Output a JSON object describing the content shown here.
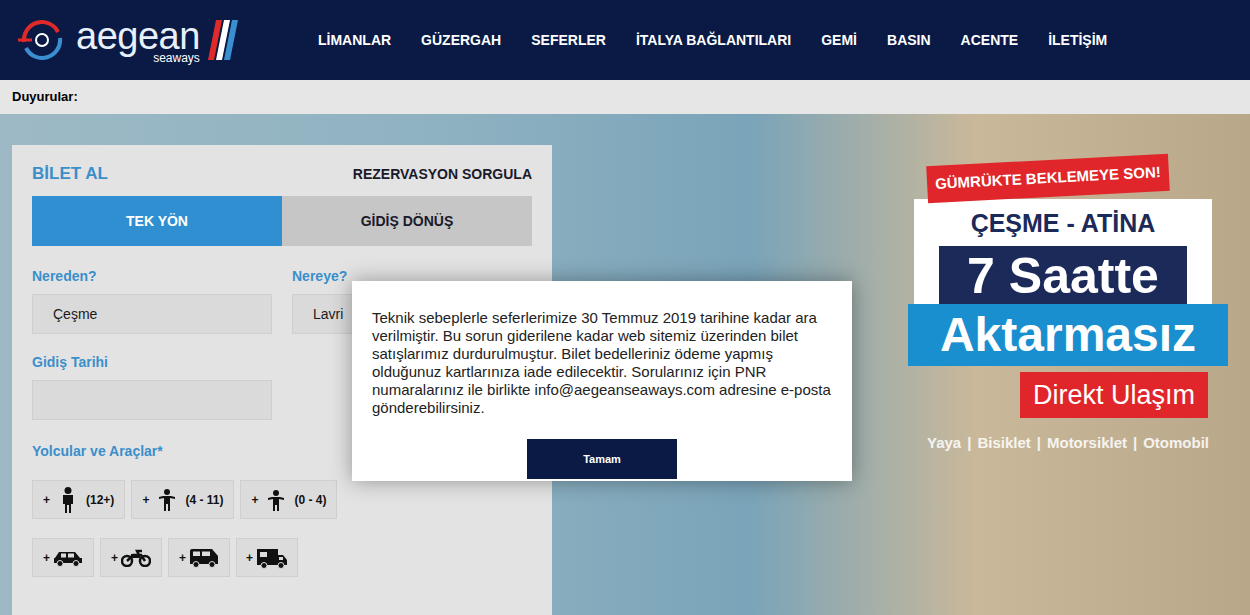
{
  "logo": {
    "name": "aegean",
    "sub": "seaways"
  },
  "nav": [
    "LİMANLAR",
    "GÜZERGAH",
    "SEFERLER",
    "İTALYA BAĞLANTILARI",
    "GEMİ",
    "BASIN",
    "ACENTE",
    "İLETİŞİM"
  ],
  "announcements": {
    "label": "Duyurular:"
  },
  "booking": {
    "title": "BİLET AL",
    "query_link": "REZERVASYON SORGULA",
    "trip_tabs": [
      {
        "label": "TEK YÖN",
        "selected": true
      },
      {
        "label": "GİDİŞ DÖNÜŞ",
        "selected": false
      }
    ],
    "from": {
      "label": "Nereden?",
      "value": "Çeşme"
    },
    "to": {
      "label": "Nereye?",
      "value": "Lavri"
    },
    "date": {
      "label": "Gidiş Tarihi",
      "value": ""
    },
    "travellers_label": "Yolcular ve Araçlar*",
    "passengers": [
      {
        "plus": "+",
        "age": "(12+)",
        "kind": "adult"
      },
      {
        "plus": "+",
        "age": "(4 - 11)",
        "kind": "child"
      },
      {
        "plus": "+",
        "age": "(0 - 4)",
        "kind": "infant"
      }
    ],
    "vehicles": [
      {
        "plus": "+",
        "kind": "car"
      },
      {
        "plus": "+",
        "kind": "motorcycle"
      },
      {
        "plus": "+",
        "kind": "van"
      },
      {
        "plus": "+",
        "kind": "caravan"
      }
    ]
  },
  "promo": {
    "banner": "GÜMRÜKTE BEKLEMEYE SON!",
    "route": "ÇEŞME - ATİNA",
    "duration": "7 Saatte",
    "direct": "Aktarmasız",
    "tagline": "Direkt Ulaşım",
    "modes": [
      "Yaya",
      "Bisiklet",
      "Motorsiklet",
      "Otomobil"
    ],
    "separator": "|"
  },
  "dialog": {
    "message": "Teknik sebeplerle seferlerimize 30 Temmuz 2019 tarihine kadar ara verilmiştir. Bu sorun giderilene kadar web sitemiz üzerinden bilet satışlarımız durdurulmuştur. Bilet bedelleriniz ödeme yapmış olduğunuz kartlarınıza iade edilecektir. Sorularınız için PNR numaralarınız ile birlikte info@aegeanseaways.com adresine e-posta gönderebilirsiniz.",
    "buttons": [
      "Tamam"
    ]
  }
}
